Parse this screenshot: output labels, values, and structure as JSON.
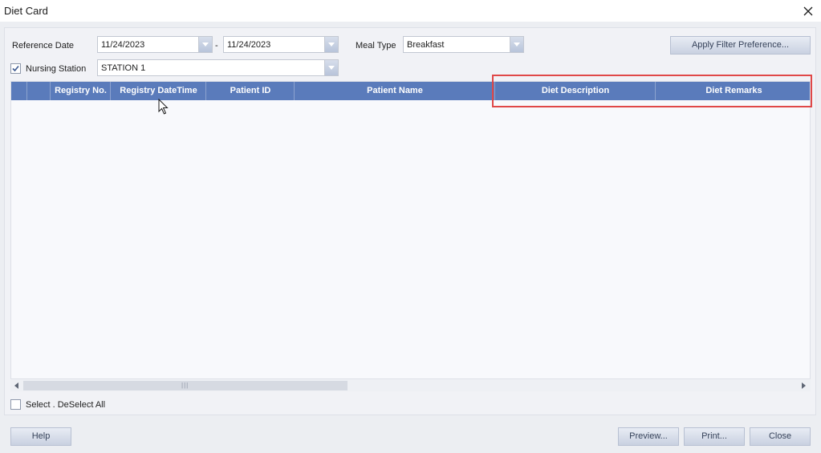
{
  "window": {
    "title": "Diet Card"
  },
  "filters": {
    "reference_date_label": "Reference Date",
    "date_from": "11/24/2023",
    "date_separator": "-",
    "date_to": "11/24/2023",
    "meal_type_label": "Meal Type",
    "meal_type_value": "Breakfast",
    "nursing_station_checked": true,
    "nursing_station_label": "Nursing Station",
    "nursing_station_value": "STATION 1",
    "apply_filter_label": "Apply Filter Preference..."
  },
  "grid": {
    "columns": [
      "Registry No.",
      "Registry DateTime",
      "Patient ID",
      "Patient Name",
      "Diet Description",
      "Diet Remarks"
    ],
    "rows": []
  },
  "selection": {
    "select_all_label": "Select . DeSelect All",
    "checked": false
  },
  "footer": {
    "help_label": "Help",
    "preview_label": "Preview...",
    "print_label": "Print...",
    "close_label": "Close"
  },
  "colors": {
    "header_bg": "#5a7bbb",
    "highlight_border": "#e04848",
    "button_text": "#36425a"
  },
  "icons": [
    "close-icon",
    "dropdown-arrow-icon",
    "checkmark-icon",
    "scroll-left-icon",
    "scroll-right-icon",
    "mouse-cursor-icon"
  ]
}
